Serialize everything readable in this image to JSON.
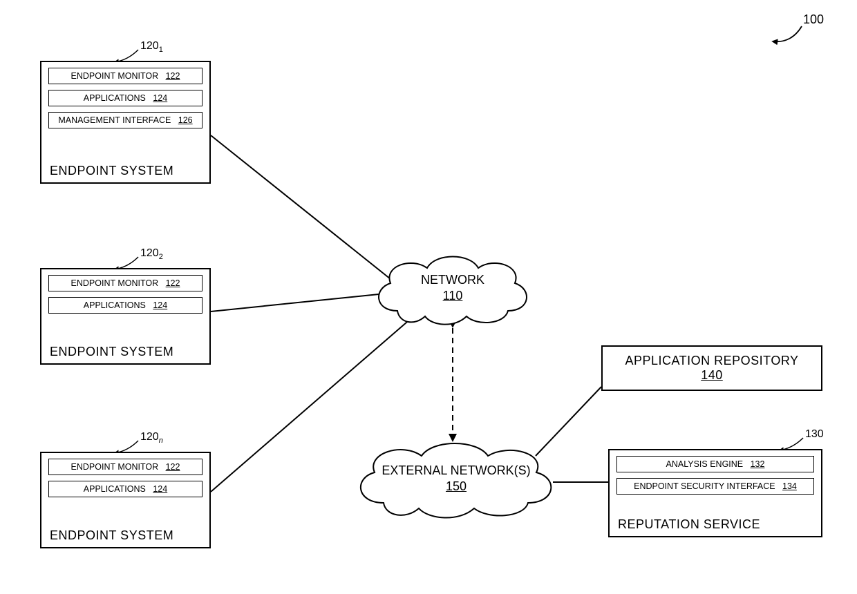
{
  "figure_ref": "100",
  "endpoint1": {
    "leader": "120",
    "leader_sub": "1",
    "title": "ENDPOINT SYSTEM",
    "monitor": "ENDPOINT MONITOR",
    "monitor_ref": "122",
    "apps": "APPLICATIONS",
    "apps_ref": "124",
    "mgmt": "MANAGEMENT INTERFACE",
    "mgmt_ref": "126"
  },
  "endpoint2": {
    "leader": "120",
    "leader_sub": "2",
    "title": "ENDPOINT SYSTEM",
    "monitor": "ENDPOINT MONITOR",
    "monitor_ref": "122",
    "apps": "APPLICATIONS",
    "apps_ref": "124"
  },
  "endpointN": {
    "leader": "120",
    "leader_sub": "n",
    "title": "ENDPOINT SYSTEM",
    "monitor": "ENDPOINT MONITOR",
    "monitor_ref": "122",
    "apps": "APPLICATIONS",
    "apps_ref": "124"
  },
  "network": {
    "label": "NETWORK",
    "ref": "110"
  },
  "external": {
    "label": "EXTERNAL NETWORK(S)",
    "ref": "150"
  },
  "repo": {
    "label": "APPLICATION REPOSITORY",
    "ref": "140"
  },
  "reputation": {
    "leader": "130",
    "title": "REPUTATION SERVICE",
    "analysis": "ANALYSIS ENGINE",
    "analysis_ref": "132",
    "esi": "ENDPOINT SECURITY INTERFACE",
    "esi_ref": "134"
  }
}
